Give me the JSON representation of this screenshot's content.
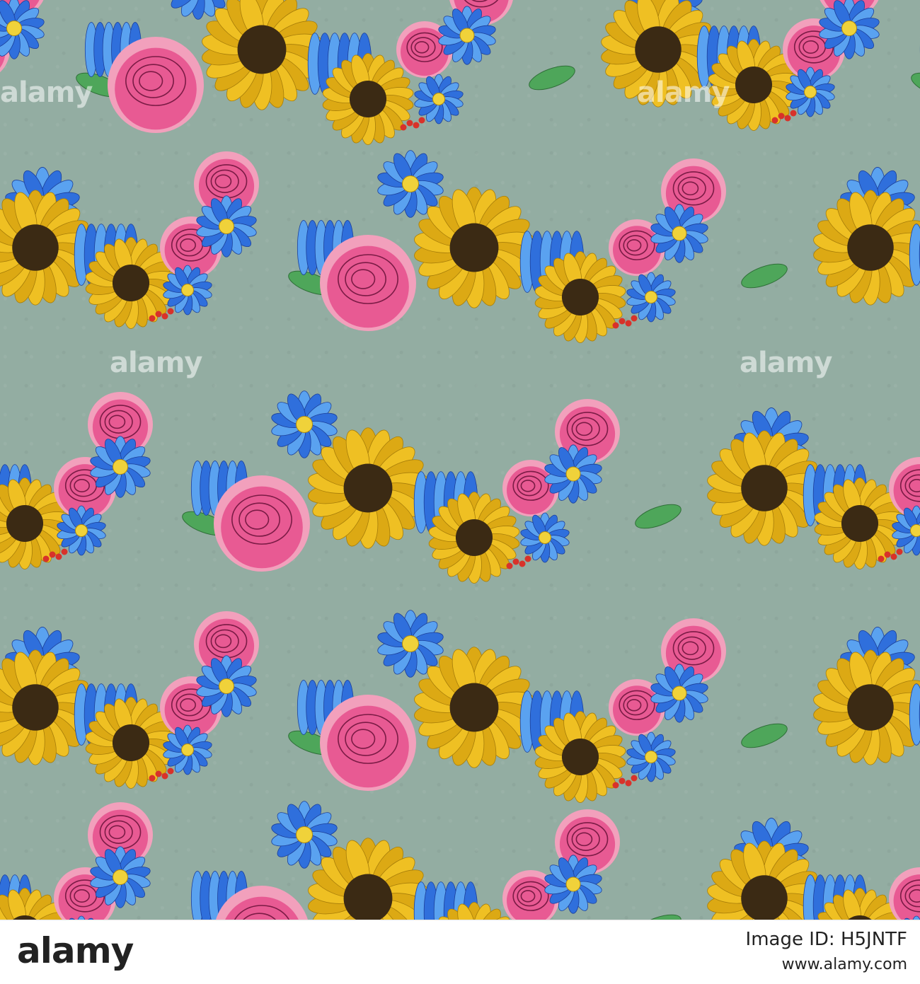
{
  "image": {
    "subject": "painted floral stripes",
    "background_color": "#93ada2",
    "palette": {
      "rose": "#e85a93",
      "rose_light": "#f2a0bc",
      "sunflower": "#efc023",
      "sunflower_center": "#3b2a14",
      "blue_flower": "#2f6fdc",
      "blue_light": "#5aa2f0",
      "leaf": "#4ea65a",
      "berry": "#d8322a"
    }
  },
  "watermarks": [
    "alamy",
    "alamy",
    "alamy",
    "alamy"
  ],
  "footer": {
    "logo": "alamy",
    "image_id": "Image ID: H5JNTF",
    "url": "www.alamy.com"
  }
}
